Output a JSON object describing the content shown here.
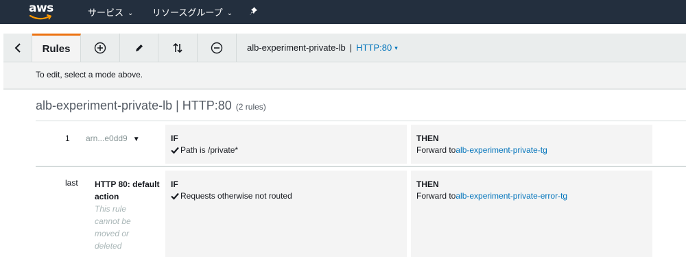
{
  "topnav": {
    "logo_text": "aws",
    "services_label": "サービス",
    "resource_groups_label": "リソースグループ"
  },
  "toolbar": {
    "rules_tab_label": "Rules",
    "lb_name": "alb-experiment-private-lb",
    "separator": "|",
    "listener": "HTTP:80"
  },
  "hint": "To edit, select a mode above.",
  "page": {
    "title": "alb-experiment-private-lb | HTTP:80",
    "rule_count": "(2 rules)"
  },
  "rules": [
    {
      "priority": "1",
      "arn": "arn...e0dd9",
      "if_label": "IF",
      "condition": "Path is /private*",
      "then_label": "THEN",
      "action_prefix": "Forward to",
      "target": "alb-experiment-private-tg"
    },
    {
      "priority": "last",
      "default_title": "HTTP 80: default action",
      "default_note": "This rule cannot be moved or deleted",
      "if_label": "IF",
      "condition": "Requests otherwise not routed",
      "then_label": "THEN",
      "action_prefix": "Forward to",
      "target": "alb-experiment-private-error-tg"
    }
  ],
  "colors": {
    "nav_bg": "#232f3e",
    "accent_tab": "#ec7211",
    "link": "#0073bb"
  }
}
